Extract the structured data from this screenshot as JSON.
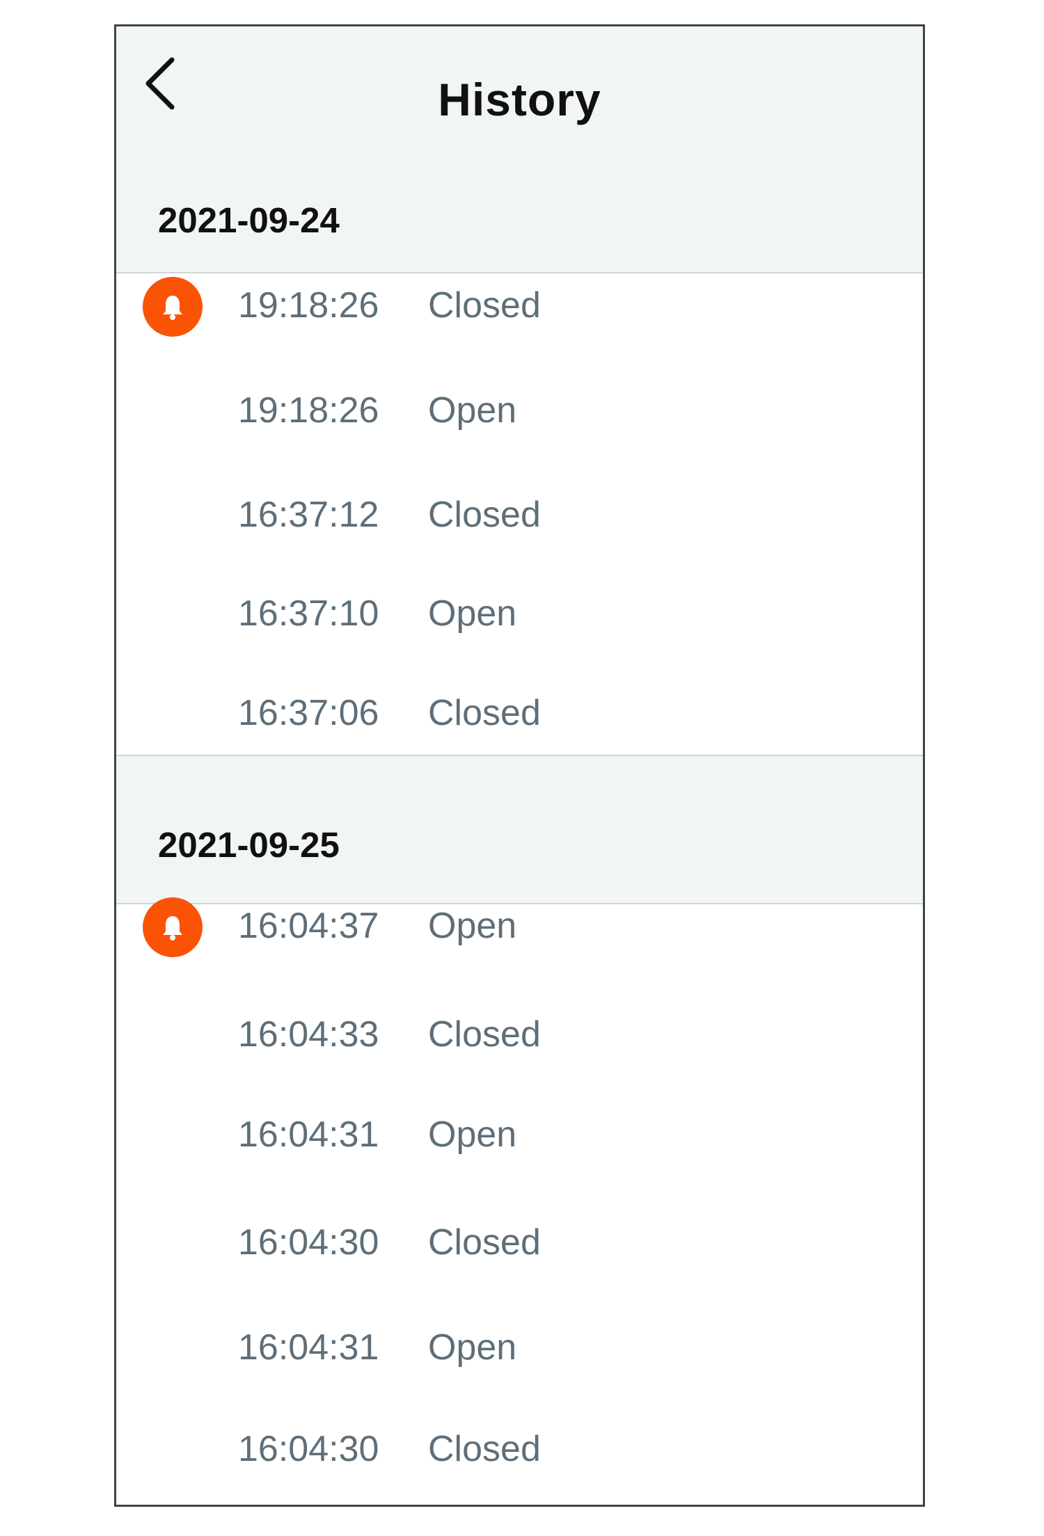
{
  "header": {
    "title": "History",
    "back_icon": "chevron-left-icon"
  },
  "colors": {
    "band_background": "#f2f5f6",
    "alert_accent": "#fb5306",
    "secondary_text": "#5e6e79"
  },
  "groups": [
    {
      "date": "2021-09-24",
      "events": [
        {
          "time": "19:18:26",
          "state": "Closed",
          "alert": true
        },
        {
          "time": "19:18:26",
          "state": "Open",
          "alert": false
        },
        {
          "time": "16:37:12",
          "state": "Closed",
          "alert": false
        },
        {
          "time": "16:37:10",
          "state": "Open",
          "alert": false
        },
        {
          "time": "16:37:06",
          "state": "Closed",
          "alert": false
        }
      ]
    },
    {
      "date": "2021-09-25",
      "events": [
        {
          "time": "16:04:37",
          "state": "Open",
          "alert": true
        },
        {
          "time": "16:04:33",
          "state": "Closed",
          "alert": false
        },
        {
          "time": "16:04:31",
          "state": "Open",
          "alert": false
        },
        {
          "time": "16:04:30",
          "state": "Closed",
          "alert": false
        },
        {
          "time": "16:04:31",
          "state": "Open",
          "alert": false
        },
        {
          "time": "16:04:30",
          "state": "Closed",
          "alert": false
        }
      ]
    }
  ]
}
